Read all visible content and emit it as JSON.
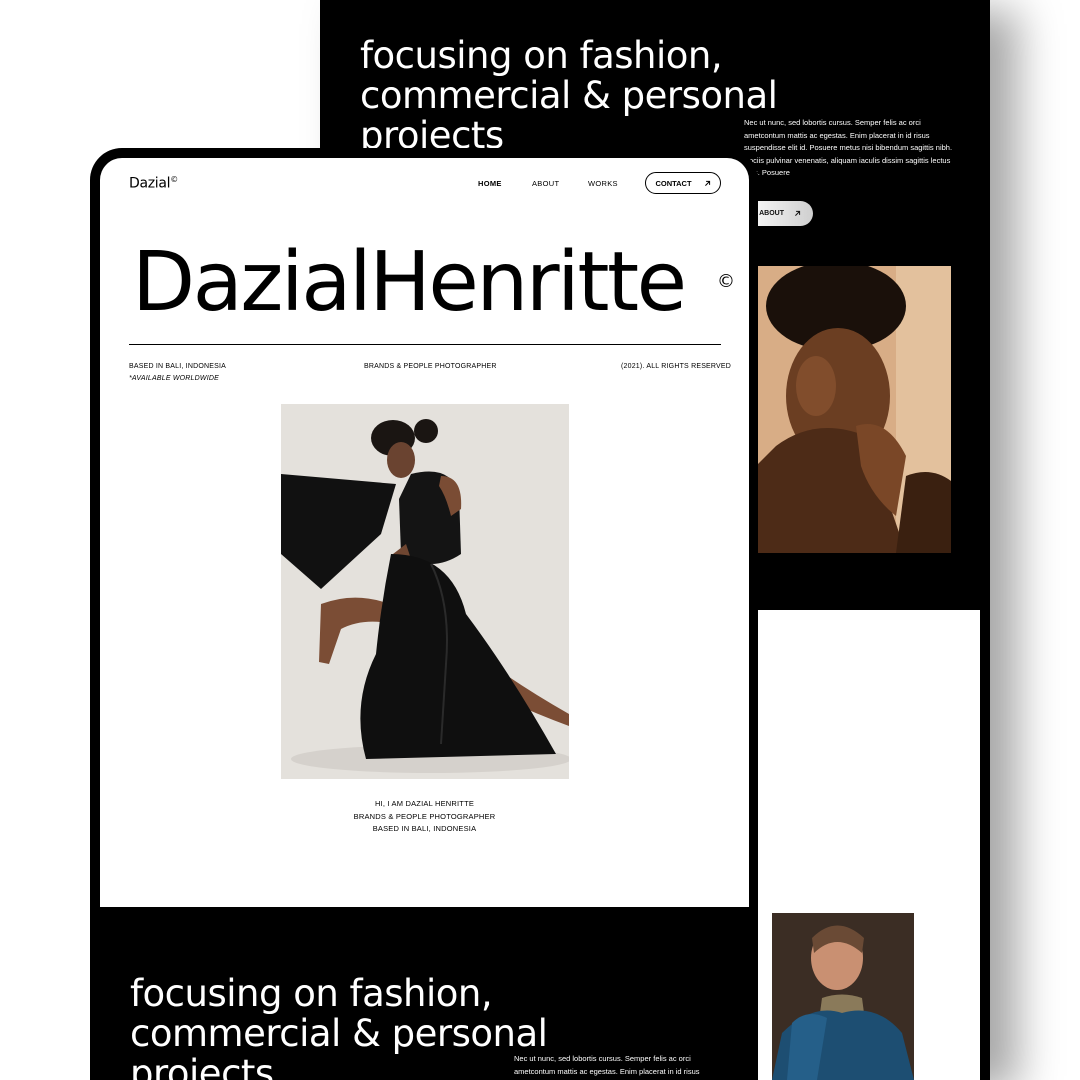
{
  "back_section": {
    "headline": "focusing on fashion, commercial & personal projects",
    "paragraph": "Nec ut nunc, sed lobortis cursus. Semper felis ac orci ametcontum mattis ac egestas. Enim placerat in id risus suspendisse elit id. Posuere metus nisi bibendum sagittis nibh. Sociis pulvinar venenatis, aliquam iaculis dissim sagittis lectus duis. Posuere",
    "about_button": "ABOUT",
    "arrow_icon": "arrow-up-right-icon"
  },
  "header": {
    "logo": "Dazial",
    "logo_mark": "©",
    "nav": {
      "home": "HOME",
      "about": "ABOUT",
      "works": "WORKS"
    },
    "contact_button": "CONTACT",
    "contact_icon": "arrow-up-right-icon"
  },
  "hero": {
    "name": "DazialHenritte",
    "copyright_mark": "©",
    "based": "BASED IN BALI, INDONESIA",
    "availability": "*AVAILABLE WORLDWIDE",
    "role": "BRANDS & PEOPLE PHOTOGRAPHER",
    "rights": "(2021). ALL RIGHTS RESERVED"
  },
  "intro": {
    "line1": "HI, I AM DAZIAL HENRITTE",
    "line2": "BRANDS & PEOPLE PHOTOGRAPHER",
    "line3": "BASED IN BALI, INDONESIA"
  },
  "front_section": {
    "headline": "focusing on fashion, commercial & personal projects",
    "paragraph": "Nec ut nunc, sed lobortis cursus. Semper felis ac orci ametcontum mattis ac egestas. Enim placerat in id risus"
  },
  "colors": {
    "background": "#ffffff",
    "device": "#000000",
    "text": "#000000"
  }
}
